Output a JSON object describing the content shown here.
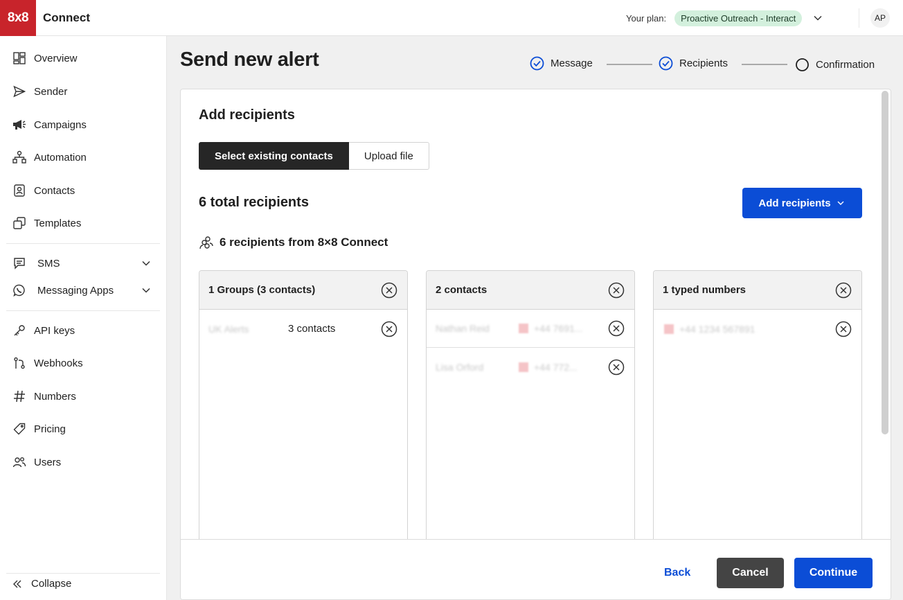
{
  "header": {
    "logo_text": "8x8",
    "brand": "Connect",
    "plan_label": "Your plan:",
    "plan_name": "Proactive Outreach - Interact",
    "avatar_initials": "AP"
  },
  "sidebar": {
    "items": [
      {
        "label": "Overview",
        "icon": "overview-icon"
      },
      {
        "label": "Sender",
        "icon": "send-icon"
      },
      {
        "label": "Campaigns",
        "icon": "megaphone-icon"
      },
      {
        "label": "Automation",
        "icon": "flow-icon"
      },
      {
        "label": "Contacts",
        "icon": "contacts-icon"
      },
      {
        "label": "Templates",
        "icon": "templates-icon"
      },
      {
        "label": "SMS",
        "icon": "chat-icon"
      },
      {
        "label": "Messaging Apps",
        "icon": "whatsapp-icon"
      },
      {
        "label": "API keys",
        "icon": "key-icon"
      },
      {
        "label": "Webhooks",
        "icon": "webhook-icon"
      },
      {
        "label": "Numbers",
        "icon": "hash-icon"
      },
      {
        "label": "Pricing",
        "icon": "tag-icon"
      },
      {
        "label": "Users",
        "icon": "users-icon"
      }
    ],
    "collapse_label": "Collapse"
  },
  "page": {
    "title": "Send new alert",
    "steps": [
      {
        "label": "Message",
        "status": "done"
      },
      {
        "label": "Recipients",
        "status": "done"
      },
      {
        "label": "Confirmation",
        "status": "pending"
      }
    ]
  },
  "card": {
    "title": "Add recipients",
    "tabs": [
      "Select existing contacts",
      "Upload file"
    ],
    "total_label": "6 total recipients",
    "add_button": "Add recipients",
    "source_label": "6 recipients from 8×8 Connect",
    "columns": [
      {
        "title": "1 Groups (3 contacts)",
        "rows": [
          {
            "name": "UK Alerts",
            "detail": "3 contacts"
          }
        ]
      },
      {
        "title": "2 contacts",
        "rows": [
          {
            "name": "Nathan Reid",
            "detail": "+44 7691..."
          },
          {
            "name": "Lisa Orford",
            "detail": "+44 772..."
          }
        ]
      },
      {
        "title": "1 typed numbers",
        "rows": [
          {
            "detail": "+44 1234 567891"
          }
        ]
      }
    ],
    "footer": {
      "back": "Back",
      "cancel": "Cancel",
      "continue": "Continue"
    }
  },
  "colors": {
    "brand_red": "#c8242b",
    "primary_blue": "#0b4dd6",
    "plan_badge_bg": "#d3f0dd",
    "dark_button": "#444444"
  }
}
